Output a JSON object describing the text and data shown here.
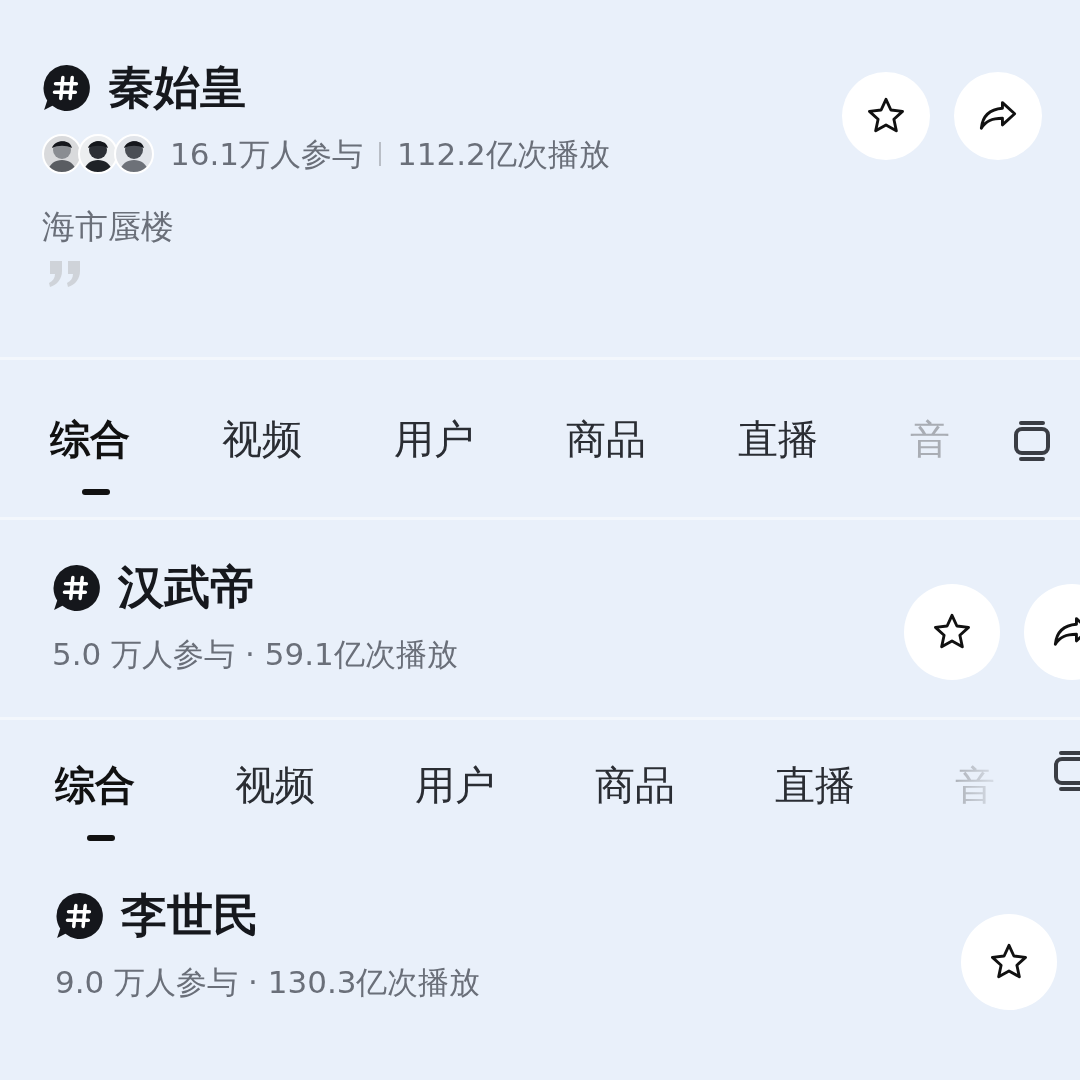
{
  "blocks": [
    {
      "kind": "topic",
      "title": "秦始皇",
      "avatars": [
        {
          "kind": "picture"
        },
        {
          "kind": "picture"
        },
        {
          "kind": "picture"
        }
      ],
      "stats": [
        "16.1万人参与",
        "112.2亿次播放"
      ],
      "description": "海市蜃楼",
      "quote_mark": true,
      "actions": [
        {
          "kind": "favorite"
        },
        {
          "kind": "share"
        }
      ]
    },
    {
      "kind": "tabs",
      "tabs": [
        {
          "label": "综合",
          "selected": true
        },
        {
          "label": "视频",
          "selected": false
        },
        {
          "label": "用户",
          "selected": false
        },
        {
          "label": "商品",
          "selected": false
        },
        {
          "label": "直播",
          "selected": false
        },
        {
          "label": "音",
          "selected": false
        }
      ]
    },
    {
      "kind": "topic",
      "title": "汉武帝",
      "stats": [
        "5.0 万人参与 · 59.1亿次播放"
      ],
      "actions": [
        {
          "kind": "favorite"
        },
        {
          "kind": "share"
        }
      ]
    },
    {
      "kind": "tabs",
      "tabs": [
        {
          "label": "综合",
          "selected": true
        },
        {
          "label": "视频",
          "selected": false
        },
        {
          "label": "用户",
          "selected": false
        },
        {
          "label": "商品",
          "selected": false
        },
        {
          "label": "直播",
          "selected": false
        },
        {
          "label": "音",
          "selected": false
        }
      ]
    },
    {
      "kind": "topic",
      "title": "李世民",
      "stats": [
        "9.0 万人参与 · 130.3亿次播放"
      ],
      "actions": [
        {
          "kind": "favorite"
        }
      ]
    }
  ]
}
